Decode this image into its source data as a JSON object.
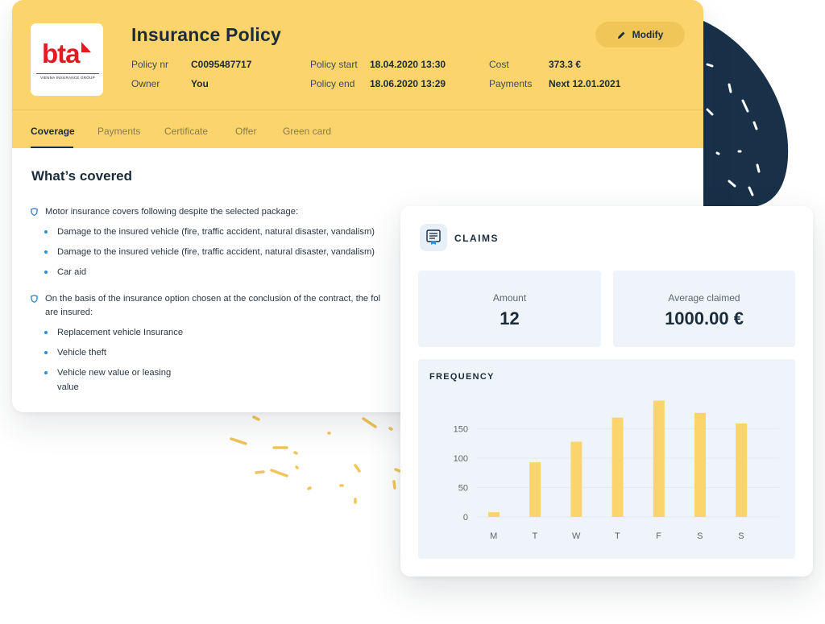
{
  "policy": {
    "logo_text": "bta",
    "logo_subtext": "VIENNA INSURANCE GROUP",
    "title": "Insurance Policy",
    "modify_label": "Modify",
    "fields": {
      "policy_nr_label": "Policy nr",
      "policy_nr_value": "C0095487717",
      "owner_label": "Owner",
      "owner_value": "You",
      "policy_start_label": "Policy start",
      "policy_start_value": "18.04.2020 13:30",
      "policy_end_label": "Policy end",
      "policy_end_value": "18.06.2020 13:29",
      "cost_label": "Cost",
      "cost_value": "373.3 €",
      "payments_label": "Payments",
      "payments_value": "Next 12.01.2021"
    },
    "tabs": [
      "Coverage",
      "Payments",
      "Certificate",
      "Offer",
      "Green card"
    ],
    "active_tab": "Coverage"
  },
  "coverage": {
    "title": "What’s covered",
    "group1_text": "Motor insurance covers following despite the selected package:",
    "group1_items": [
      "Damage to the insured vehicle (fire, traffic accident, natural disaster, vandalism)",
      "Damage to the insured vehicle (fire, traffic accident, natural disaster, vandalism)",
      "Car aid"
    ],
    "group2_text_line1": "On the basis of the insurance option chosen at the conclusion of the contract, the fol",
    "group2_text_line2": "are insured:",
    "group2_items": [
      "Replacement vehicle Insurance",
      "Vehicle theft",
      "Vehicle new value or leasing"
    ],
    "group2_item3_cont": "value"
  },
  "claims": {
    "title": "CLAIMS",
    "amount_label": "Amount",
    "amount_value": "12",
    "average_label": "Average claimed",
    "average_value": "1000.00 €",
    "frequency_title": "FREQUENCY"
  },
  "colors": {
    "header_yellow": "#fbd56c",
    "bar_yellow": "#fbd56c",
    "navy": "#183149",
    "accent_blue": "#2e8fd6"
  },
  "chart_data": {
    "type": "bar",
    "title": "FREQUENCY",
    "categories": [
      "M",
      "T",
      "W",
      "T",
      "F",
      "S",
      "S"
    ],
    "values": [
      8,
      93,
      128,
      169,
      198,
      177,
      159
    ],
    "yticks": [
      0,
      50,
      100,
      150
    ],
    "ylim": [
      0,
      200
    ],
    "xlabel": "",
    "ylabel": "",
    "grid": true
  }
}
